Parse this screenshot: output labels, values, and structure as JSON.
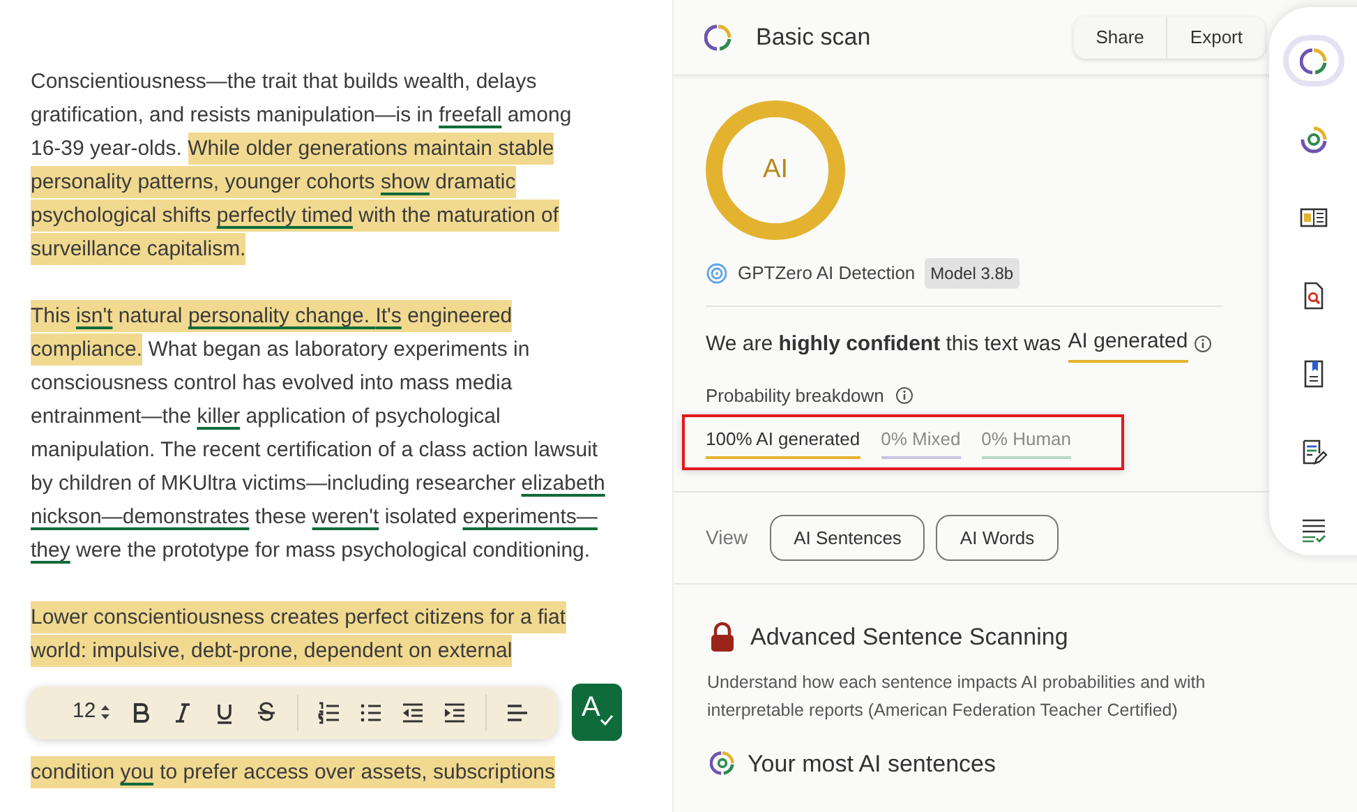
{
  "document": {
    "paragraphs": [
      {
        "segments": [
          {
            "text": "Conscientiousness—the trait that builds wealth, delays gratification, and resists manipulation—is in ",
            "highlighted": false,
            "underlined": false
          },
          {
            "text": "freefall",
            "highlighted": false,
            "underlined": true
          },
          {
            "text": " among 16-39 year-olds. ",
            "highlighted": false,
            "underlined": false
          },
          {
            "text": "While older generations maintain stable personality patterns, younger cohorts ",
            "highlighted": true,
            "underlined": false
          },
          {
            "text": "show",
            "highlighted": true,
            "underlined": true
          },
          {
            "text": " dramatic psychological shifts ",
            "highlighted": true,
            "underlined": false
          },
          {
            "text": "perfectly timed",
            "highlighted": true,
            "underlined": true
          },
          {
            "text": " with the maturation of surveillance capitalism.",
            "highlighted": true,
            "underlined": false
          }
        ]
      },
      {
        "segments": [
          {
            "text": "This ",
            "highlighted": true,
            "underlined": false
          },
          {
            "text": "isn't",
            "highlighted": true,
            "underlined": true
          },
          {
            "text": " natural ",
            "highlighted": true,
            "underlined": false
          },
          {
            "text": "personality change. ",
            "highlighted": true,
            "underlined": true
          },
          {
            "text": "It's",
            "highlighted": true,
            "underlined": true
          },
          {
            "text": " engineered compliance.",
            "highlighted": true,
            "underlined": false
          },
          {
            "text": " What began as laboratory experiments in consciousness control has evolved into mass media entrainment—the ",
            "highlighted": false,
            "underlined": false
          },
          {
            "text": "killer",
            "highlighted": false,
            "underlined": true
          },
          {
            "text": " application of psychological manipulation. The recent certification of a class action lawsuit by children of MKUltra victims—including researcher ",
            "highlighted": false,
            "underlined": false
          },
          {
            "text": "elizabeth nickson—demonstrates",
            "highlighted": false,
            "underlined": true
          },
          {
            "text": " these ",
            "highlighted": false,
            "underlined": false
          },
          {
            "text": "weren't",
            "highlighted": false,
            "underlined": true
          },
          {
            "text": " isolated ",
            "highlighted": false,
            "underlined": false
          },
          {
            "text": "experiments—they",
            "highlighted": false,
            "underlined": true
          },
          {
            "text": " were the prototype for mass psychological conditioning.",
            "highlighted": false,
            "underlined": false
          }
        ]
      },
      {
        "segments": [
          {
            "text": "Lower conscientiousness creates perfect citizens for a fiat world: impulsive, debt-prone, dependent on external",
            "highlighted": true,
            "underlined": false
          }
        ]
      },
      {
        "segments": [
          {
            "text": "condition ",
            "highlighted": true,
            "underlined": false
          },
          {
            "text": "you",
            "highlighted": true,
            "underlined": true
          },
          {
            "text": " to prefer access over assets, subscriptions",
            "highlighted": true,
            "underlined": false
          }
        ]
      }
    ]
  },
  "toolbar": {
    "font_size": "12",
    "grammar_button": "A"
  },
  "scan": {
    "title": "Basic scan",
    "buttons": [
      "Share",
      "Export"
    ],
    "ring_label": "AI",
    "detector": "GPTZero AI Detection",
    "model_badge": "Model 3.8b",
    "verdict": "We are **highly confident** this text was",
    "verdict_label": "AI generated",
    "breakdown_title": "Probability breakdown",
    "breakdown": [
      {
        "label": "100% AI generated",
        "color": "#e3b32f",
        "selected": true
      },
      {
        "label": "0% Mixed",
        "color": "#c9c4e2",
        "selected": false
      },
      {
        "label": "0% Human",
        "color": "#b7d9c4",
        "selected": false
      }
    ],
    "view_label": "View",
    "view_buttons": [
      "AI Sentences",
      "AI Words"
    ],
    "advanced_title": "Advanced Sentence Scanning",
    "advanced_text": "Understand how each sentence impacts AI probabilities and with interpretable reports (American Federation Teacher Certified)",
    "next_title": "Your most AI sentences"
  },
  "rail": {
    "items": [
      {
        "selected": true
      },
      {
        "selected": false
      },
      {
        "selected": false
      },
      {
        "selected": false
      },
      {
        "selected": false
      },
      {
        "selected": false
      },
      {
        "selected": false
      }
    ]
  }
}
